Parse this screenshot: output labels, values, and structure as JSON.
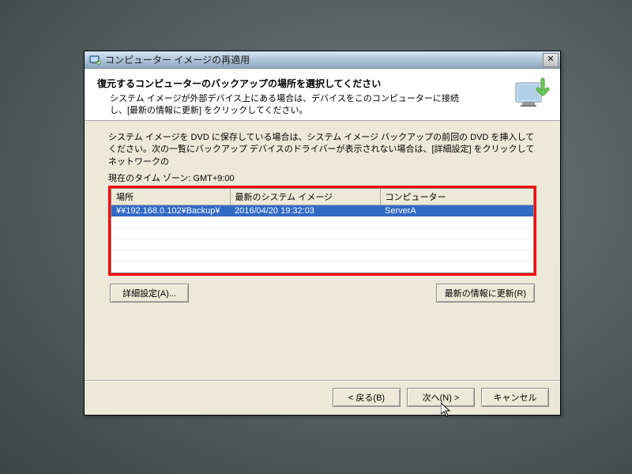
{
  "titlebar": {
    "icon_name": "computer-image-icon",
    "title": "コンピューター イメージの再適用"
  },
  "header": {
    "title": "復元するコンピューターのバックアップの場所を選択してください",
    "description": "システム イメージが外部デバイス上にある場合は、デバイスをこのコンピューターに接続し、[最新の情報に更新] をクリックしてください。"
  },
  "content": {
    "description": "システム イメージを DVD に保存している場合は、システム イメージ バックアップの前回の DVD を挿入してください。次の一覧にバックアップ デバイスのドライバーが表示されない場合は、[詳細設定] をクリックしてネットワークの",
    "timezone_label": "現在のタイム ゾーン: GMT+9:00"
  },
  "table": {
    "columns": [
      "場所",
      "最新のシステム イメージ",
      "コンピューター"
    ],
    "rows": [
      {
        "location": "¥¥192.168.0.102¥Backup¥",
        "latest": "2016/04/20 19:32:03",
        "computer": "ServerA",
        "selected": true
      }
    ]
  },
  "buttons": {
    "advanced": "詳細設定(A)...",
    "refresh": "最新の情報に更新(R)",
    "back": "< 戻る(B)",
    "next": "次へ(N) >",
    "cancel": "キャンセル"
  }
}
